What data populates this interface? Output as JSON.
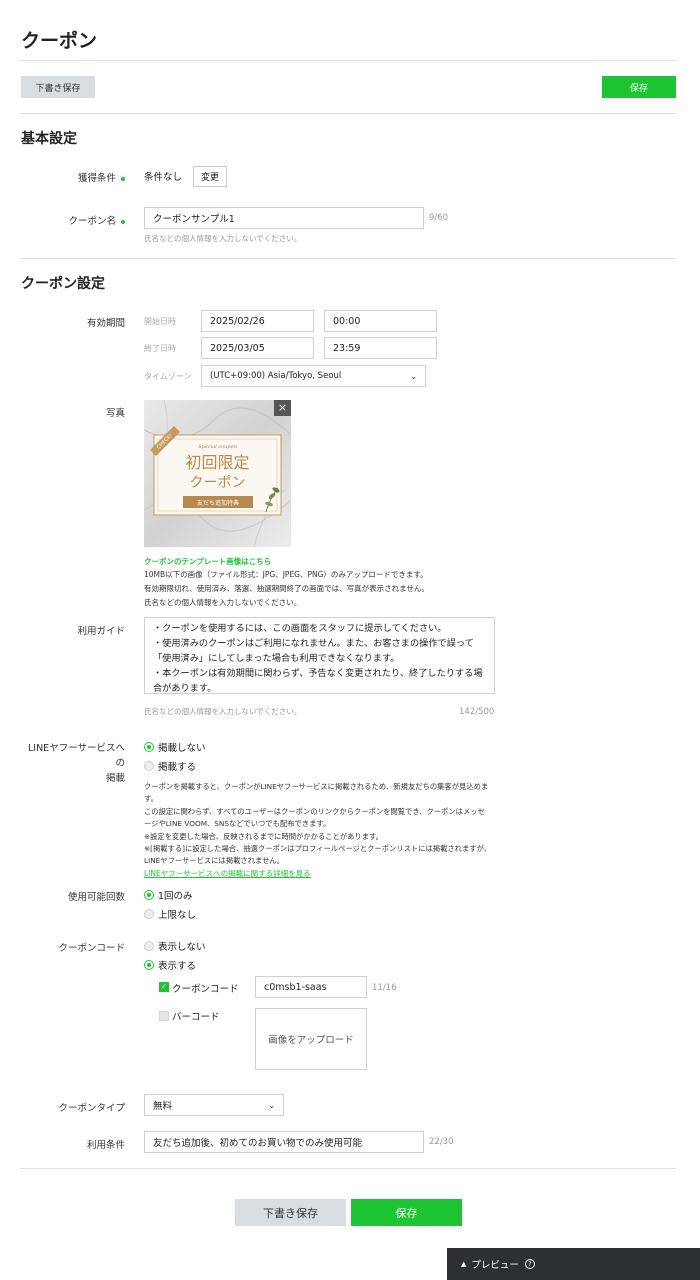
{
  "page": {
    "title": "クーポン",
    "draft_button": "下書き保存",
    "save_button": "保存"
  },
  "basic": {
    "section_title": "基本設定",
    "acquisition": {
      "label": "獲得条件",
      "value": "条件なし",
      "change_button": "変更"
    },
    "coupon_name": {
      "label": "クーポン名",
      "value": "クーポンサンプル1",
      "counter": "9/60",
      "hint": "氏名などの個人情報を入力しないでください。"
    }
  },
  "coupon_settings": {
    "section_title": "クーポン設定",
    "validity": {
      "label": "有効期間",
      "start_label": "開始日時",
      "start_date": "2025/02/26",
      "start_time": "00:00",
      "end_label": "終了日時",
      "end_date": "2025/03/05",
      "end_time": "23:59",
      "tz_label": "タイムゾーン",
      "tz_value": "(UTC+09:00) Asia/Tokyo, Seoul"
    },
    "photo": {
      "label": "写真",
      "image_script": "Special coupon",
      "image_badge": "CHECK!",
      "image_title_1": "初回限定",
      "image_title_2": "クーポン",
      "image_ribbon": "友だち追加特典",
      "template_link": "クーポンのテンプレート画像はこちら",
      "note_1": "10MB以下の画像（ファイル形式：JPG、JPEG、PNG）のみアップロードできます。",
      "note_2": "有効期限切れ、使用済み、落選、抽選期間終了の画面では、写真が表示されません。",
      "note_3": "氏名などの個人情報を入力しないでください。"
    },
    "guide": {
      "label": "利用ガイド",
      "lines": [
        "・クーポンを使用するには、この画面をスタッフに提示してください。",
        "・使用済みのクーポンはご利用になれません。また、お客さまの操作で誤って",
        "「使用済み」にしてしまった場合も利用できなくなります。",
        "・本クーポンは有効期間に関わらず、予告なく変更されたり、終了したりする場",
        "合があります。"
      ],
      "hint": "氏名などの個人情報を入力しないでください。",
      "counter": "142/500"
    },
    "line_yahoo": {
      "label_1": "LINEヤフーサービスへの",
      "label_2": "掲載",
      "opt_no": "掲載しない",
      "opt_yes": "掲載する",
      "desc_1": "クーポンを掲載すると、クーポンがLINEヤフーサービスに掲載されるため、新規友だちの集客が見込めま",
      "desc_2": "す。",
      "desc_3": "この設定に関わらず、すべてのユーザーはクーポンのリンクからクーポンを閲覧でき、クーポンはメッセ",
      "desc_4": "ージやLINE VOOM、SNSなどでいつでも配布できます。",
      "desc_5": "※設定を変更した場合、反映されるまでに時間がかかることがあります。",
      "desc_6": "※[掲載する]に設定した場合、抽選クーポンはプロフィールページとクーポンリストには掲載されますが、",
      "desc_7": "LINEヤフーサービスには掲載されません。",
      "link": "LINEヤフーサービスへの掲載に関する詳細を見る"
    },
    "usage_count": {
      "label": "使用可能回数",
      "opt_once": "1回のみ",
      "opt_unlimited": "上限なし"
    },
    "coupon_code": {
      "label": "クーポンコード",
      "opt_hide": "表示しない",
      "opt_show": "表示する",
      "code_check_label": "クーポンコード",
      "code_value": "c0msb1-saas",
      "code_counter": "11/16",
      "barcode_label": "バーコード",
      "upload_label": "画像をアップロード"
    },
    "coupon_type": {
      "label": "クーポンタイプ",
      "value": "無料"
    },
    "terms": {
      "label": "利用条件",
      "value": "友だち追加後、初めてのお買い物でのみ使用可能",
      "counter": "22/30"
    }
  },
  "footer": {
    "draft_button": "下書き保存",
    "save_button": "保存"
  },
  "preview": {
    "label": "プレビュー"
  },
  "colors": {
    "accent": "#1ec533",
    "dark": "#2c2f33",
    "gray_button": "#d9dde2"
  }
}
